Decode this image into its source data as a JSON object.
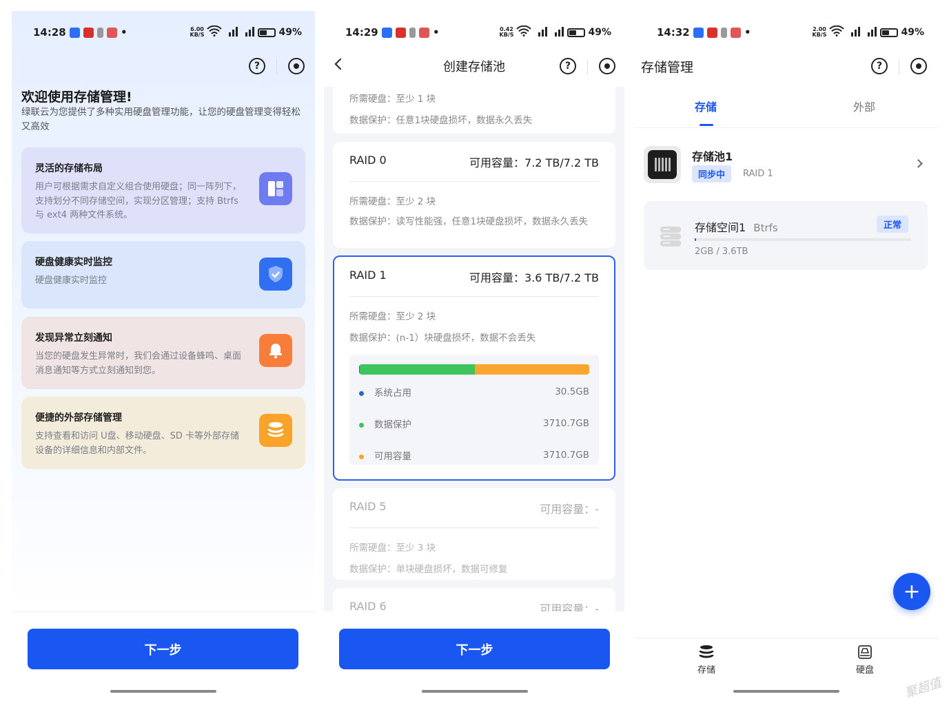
{
  "colors": {
    "accent": "#1a56f0",
    "green": "#3dc45c",
    "orange": "#f9a52f",
    "blue_dot": "#2c64d8"
  },
  "status": [
    {
      "time": "14:28",
      "net": "6.00",
      "net_unit": "KB/S",
      "battery": "49%"
    },
    {
      "time": "14:29",
      "net": "0.42",
      "net_unit": "KB/S",
      "battery": "49%"
    },
    {
      "time": "14:32",
      "net": "2.00",
      "net_unit": "KB/S",
      "battery": "49%"
    }
  ],
  "icons": {
    "help": "?",
    "bullet": "•"
  },
  "welcome": {
    "title": "欢迎使用存储管理!",
    "intro": "绿联云为您提供了多种实用硬盘管理功能，让您的硬盘管理变得轻松又高效",
    "features": [
      {
        "title": "灵活的存储布局",
        "desc": "用户可根据需求自定义组合使用硬盘；同一阵列下，支持划分不同存储空间，实现分区管理；支持 Btrfs 与 ext4 两种文件系统。",
        "icon": "layout-icon",
        "color": "#6f7bf0"
      },
      {
        "title": "硬盘健康实时监控",
        "desc": "硬盘健康实时监控",
        "icon": "shield-icon",
        "color": "#2f6ff0"
      },
      {
        "title": "发现异常立刻通知",
        "desc": "当您的硬盘发生异常时，我们会通过设备蜂鸣、桌面消息通知等方式立刻通知到您。",
        "icon": "bell-icon",
        "color": "#f97d3a"
      },
      {
        "title": "便捷的外部存储管理",
        "desc": "支持查看和访问 U盘、移动硬盘、SD 卡等外部存储设备的详细信息和内部文件。",
        "icon": "database-icon",
        "color": "#f9a32a"
      }
    ],
    "next": "下一步"
  },
  "create": {
    "title": "创建存储池",
    "top_card": {
      "disks": "所需硬盘：至少 1 块",
      "protect": "数据保护：任意1块硬盘损坏，数据永久丢失"
    },
    "raids": [
      {
        "name": "RAID 0",
        "cap": "可用容量：7.2 TB/7.2 TB",
        "disks": "所需硬盘：至少 2 块",
        "protect": "数据保护：读写性能强，任意1块硬盘损坏，数据永久丢失"
      },
      {
        "name": "RAID 1",
        "cap": "可用容量：3.6 TB/7.2 TB",
        "disks": "所需硬盘：至少 2 块",
        "protect": "数据保护：(n-1）块硬盘损坏，数据不会丢失"
      },
      {
        "name": "RAID 5",
        "cap": "可用容量：-",
        "disks": "所需硬盘：至少 3 块",
        "protect": "数据保护：单块硬盘损坏，数据可修复"
      },
      {
        "name": "RAID 6",
        "cap": "可用容量：-"
      }
    ],
    "usage": [
      {
        "label": "系统占用",
        "value": "30.5GB",
        "fraction": 0.004
      },
      {
        "label": "数据保护",
        "value": "3710.7GB",
        "fraction": 0.498
      },
      {
        "label": "可用容量",
        "value": "3710.7GB",
        "fraction": 0.498
      }
    ],
    "next": "下一步"
  },
  "manage": {
    "title": "存储管理",
    "tabs": [
      "存储",
      "外部"
    ],
    "pool": {
      "name": "存储池1",
      "badge": "同步中",
      "raid": "RAID 1"
    },
    "space": {
      "name": "存储空间1",
      "fs": "Btrfs",
      "status": "正常",
      "usage": "2GB / 3.6TB",
      "fraction": 0.001
    },
    "fab": "+",
    "nav": [
      "存储",
      "硬盘"
    ]
  },
  "watermark": "聚超值"
}
